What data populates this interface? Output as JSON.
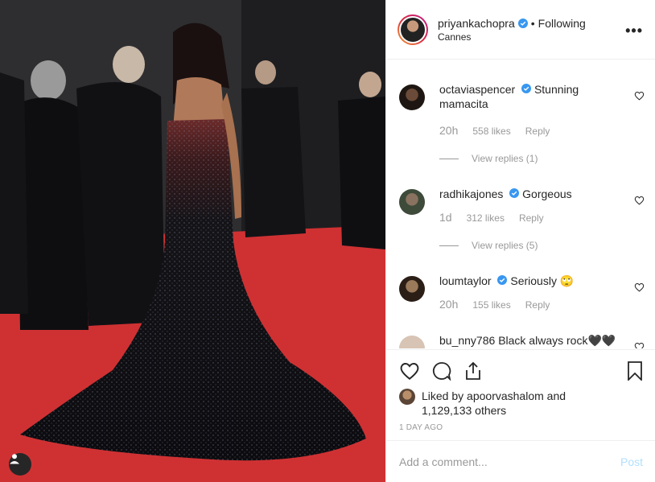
{
  "post": {
    "username": "priyankachopra",
    "follow_status": "Following",
    "location": "Cannes"
  },
  "comments": [
    {
      "user": "octaviaspencer",
      "text": "Stunning mamacita",
      "time": "20h",
      "likes": "558 likes",
      "reply": "Reply",
      "view_replies": "View replies (1)",
      "avatar_color": "#3a2a1e"
    },
    {
      "user": "radhikajones",
      "text": "Gorgeous",
      "time": "1d",
      "likes": "312 likes",
      "reply": "Reply",
      "view_replies": "View replies (5)",
      "avatar_color": "#6b5d4c"
    },
    {
      "user": "loumtaylor",
      "text": "Seriously 🙄",
      "time": "20h",
      "likes": "155 likes",
      "reply": "Reply",
      "avatar_color": "#4a3322"
    },
    {
      "user": "bu_nny786",
      "text": "Black always rock🖤🖤"
    }
  ],
  "likes": {
    "prefix": "Liked by",
    "user": "apoorvashalom",
    "and": "and",
    "others": "1,129,133 others"
  },
  "timestamp": "1 DAY AGO",
  "comment_box": {
    "placeholder": "Add a comment...",
    "post_label": "Post"
  },
  "colors": {
    "verified": "#3897f0",
    "red_carpet": "#c72c2f",
    "post_disabled": "#b2dffc"
  }
}
